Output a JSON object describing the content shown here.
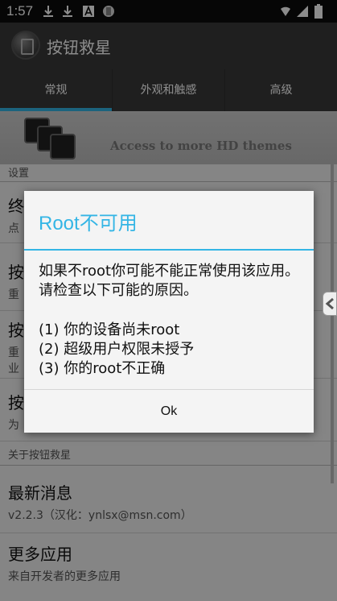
{
  "status": {
    "time": "1:57"
  },
  "app": {
    "title": "按钮救星"
  },
  "tabs": [
    {
      "label": "常规"
    },
    {
      "label": "外观和触感"
    },
    {
      "label": "高级"
    }
  ],
  "banner": {
    "text": "Access to more HD themes"
  },
  "settings": {
    "section_label": "设置",
    "items": [
      {
        "title": "终",
        "subtitle": "点"
      },
      {
        "title": "按",
        "subtitle": "重"
      },
      {
        "title": "按",
        "subtitle": "重",
        "subtitle2": "业"
      },
      {
        "title": "按",
        "subtitle": "为"
      }
    ]
  },
  "about": {
    "section_label": "关于按钮救星",
    "items": [
      {
        "title": "最新消息",
        "subtitle": "v2.2.3（汉化：ynlsx@msn.com）"
      },
      {
        "title": "更多应用",
        "subtitle": "来自开发者的更多应用"
      }
    ]
  },
  "dialog": {
    "title": "Root不可用",
    "message": "如果不root你可能不能正常使用该应用。请检查以下可能的原因。",
    "reasons": [
      "(1) 你的设备尚未root",
      "(2) 超级用户权限未授予",
      "(3) 你的root不正确"
    ],
    "ok_label": "Ok"
  },
  "colors": {
    "accent": "#33b5e5",
    "appbar": "#3a3a3a"
  }
}
